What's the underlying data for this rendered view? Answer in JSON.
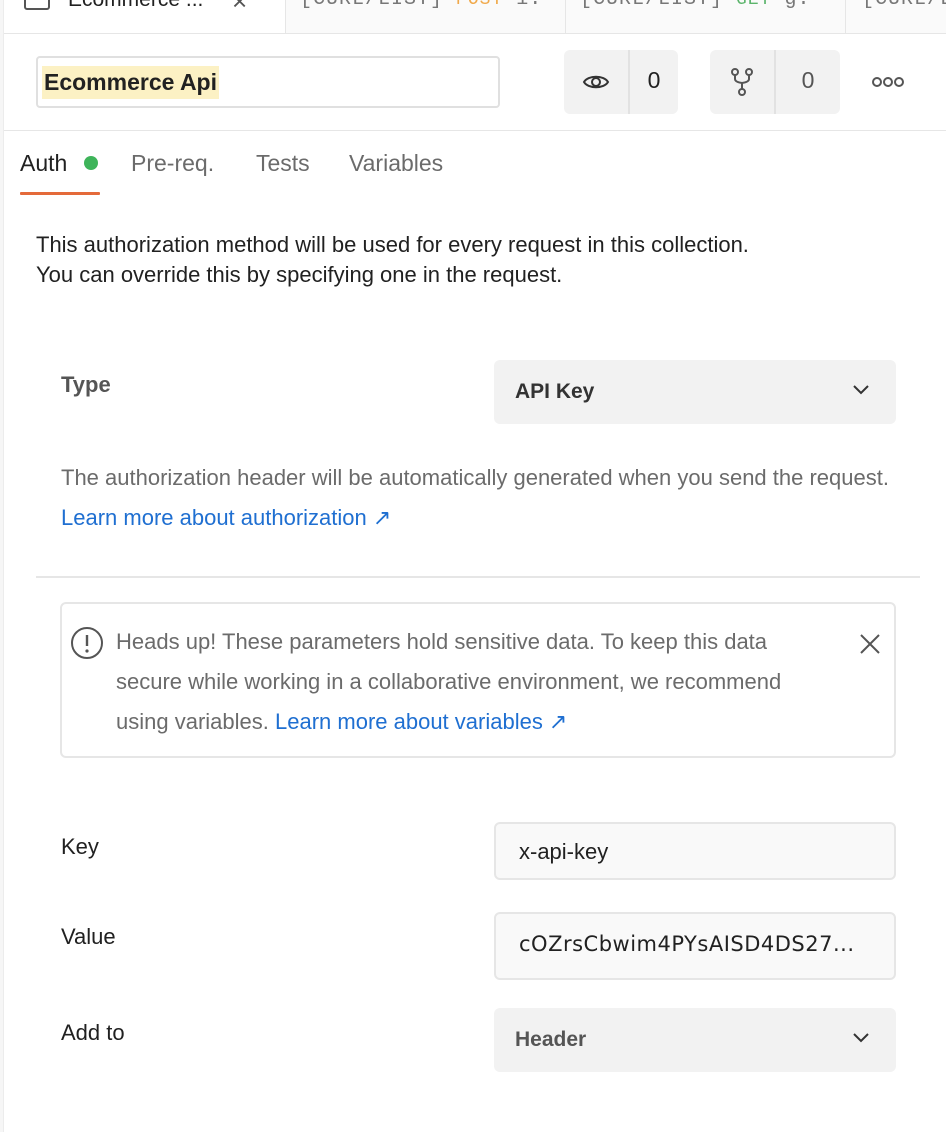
{
  "tabs": {
    "active_title": "Ecommerce ...",
    "t2_prefix": "[CURL/LIST]",
    "t2_method": "POST",
    "t2_suffix": "i.",
    "t3_prefix": "[CURL/LIST]",
    "t3_method": "GET",
    "t3_suffix": "g.",
    "t4_prefix": "[CURL/LI"
  },
  "header": {
    "collection_name": "Ecommerce Api",
    "watch_count": "0",
    "fork_count": "0"
  },
  "subtabs": {
    "auth": "Auth",
    "prereq": "Pre-req.",
    "tests": "Tests",
    "variables": "Variables"
  },
  "description": {
    "line1": "This authorization method will be used for every request in this collection.",
    "line2": "You can override this by specifying one in the request."
  },
  "type": {
    "label": "Type",
    "selected": "API Key"
  },
  "auth_help": {
    "text": "The authorization header will be automatically generated when you send the request.",
    "link": "Learn more about authorization ↗"
  },
  "notice": {
    "text": "Heads up! These parameters hold sensitive data. To keep this data secure while working in a collaborative environment, we recommend using variables.",
    "link": "Learn more about variables ↗"
  },
  "fields": {
    "key_label": "Key",
    "key_value": "x-api-key",
    "value_label": "Value",
    "value_value": "cOZrsCbwim4PYsAISD4DS27...",
    "addto_label": "Add to",
    "addto_selected": "Header"
  },
  "colors": {
    "accent_underline": "#e46a3a",
    "status_dot": "#3eb45a",
    "link": "#1f6fd1",
    "highlight": "#fcf1c4"
  }
}
